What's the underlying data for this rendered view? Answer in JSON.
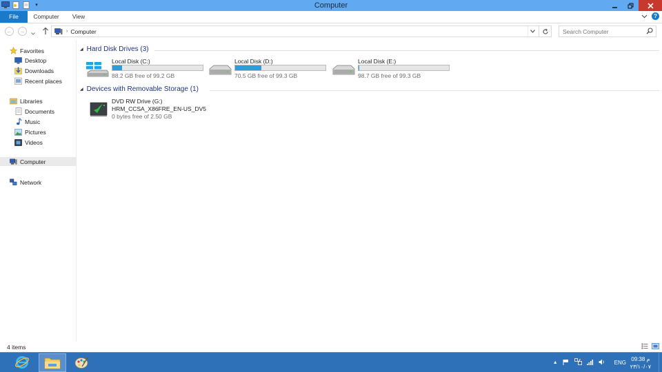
{
  "window": {
    "title": "Computer"
  },
  "ribbon": {
    "tabs": [
      "File",
      "Computer",
      "View"
    ]
  },
  "address": {
    "crumb": "Computer"
  },
  "search": {
    "placeholder": "Search Computer"
  },
  "navpane": {
    "favorites": {
      "label": "Favorites",
      "items": [
        "Desktop",
        "Downloads",
        "Recent places"
      ]
    },
    "libraries": {
      "label": "Libraries",
      "items": [
        "Documents",
        "Music",
        "Pictures",
        "Videos"
      ]
    },
    "computer": "Computer",
    "network": "Network"
  },
  "groups": {
    "hdd": {
      "title": "Hard Disk Drives (3)",
      "drives": [
        {
          "name": "Local Disk (C:)",
          "free": "88.2 GB free of 99.2 GB",
          "used_fraction": 0.11
        },
        {
          "name": "Local Disk (D:)",
          "free": "70.5 GB free of 99.3 GB",
          "used_fraction": 0.29
        },
        {
          "name": "Local Disk (E:)",
          "free": "98.7 GB free of 99.3 GB",
          "used_fraction": 0.01
        }
      ]
    },
    "removable": {
      "title": "Devices with Removable Storage (1)",
      "drive": {
        "name": "DVD RW Drive (G:)",
        "label": "HRM_CCSA_X86FRE_EN-US_DV5",
        "free": "0 bytes free of 2.50 GB"
      }
    }
  },
  "status": {
    "count": "4 items"
  },
  "taskbar": {
    "tray": {
      "lang": "ENG"
    },
    "clock": {
      "time": "09:38 م",
      "date": "۲۳/۱۰/۰۷"
    }
  },
  "colors": {
    "titlebar": "#61a9f0",
    "accent": "#1979ca",
    "driveBar": "#26a0da",
    "taskbar": "#2f71b8",
    "close": "#c7392d"
  },
  "icons": [
    "computer-icon",
    "folder-icon",
    "star-icon",
    "desktop-icon",
    "downloads-icon",
    "recent-icon",
    "library-icon",
    "documents-icon",
    "music-icon",
    "pictures-icon",
    "videos-icon",
    "network-icon",
    "hard-disk-icon",
    "windows-disk-icon",
    "dvd-drive-icon",
    "search-icon",
    "refresh-icon",
    "help-icon",
    "ie-icon",
    "explorer-icon",
    "paint-icon"
  ]
}
